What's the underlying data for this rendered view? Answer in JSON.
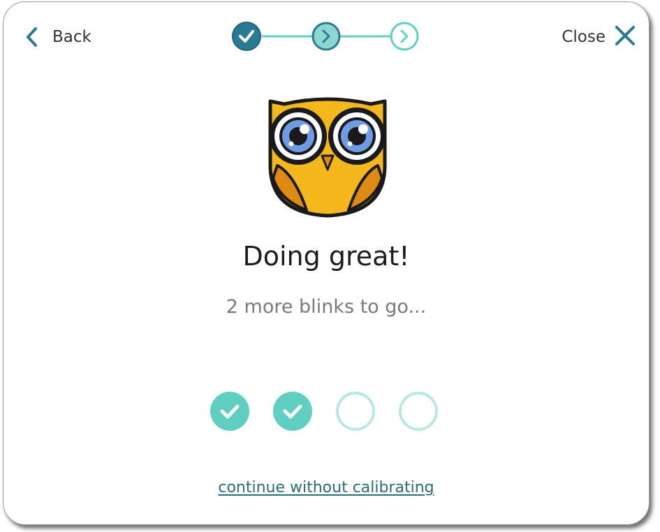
{
  "header": {
    "back_label": "Back",
    "close_label": "Close"
  },
  "stepper": {
    "steps": [
      {
        "state": "completed"
      },
      {
        "state": "current"
      },
      {
        "state": "upcoming"
      }
    ]
  },
  "main": {
    "title": "Doing great!",
    "subtitle": "2 more blinks to go..."
  },
  "blink_progress": {
    "completed": 2,
    "total": 4
  },
  "footer": {
    "continue_link": "continue without calibrating"
  },
  "colors": {
    "primary_dark": "#2a7a93",
    "accent_teal": "#5fcfc2",
    "accent_light": "#b7e8e2",
    "link": "#2c6b79",
    "owl_body": "#f5b81c",
    "owl_wing": "#df8a12",
    "owl_eye": "#6d9ce5"
  },
  "icons": {
    "back": "chevron-left-icon",
    "close": "close-x-icon",
    "step_done": "check-icon",
    "step_next": "chevron-right-icon",
    "mascot": "owl-icon"
  }
}
